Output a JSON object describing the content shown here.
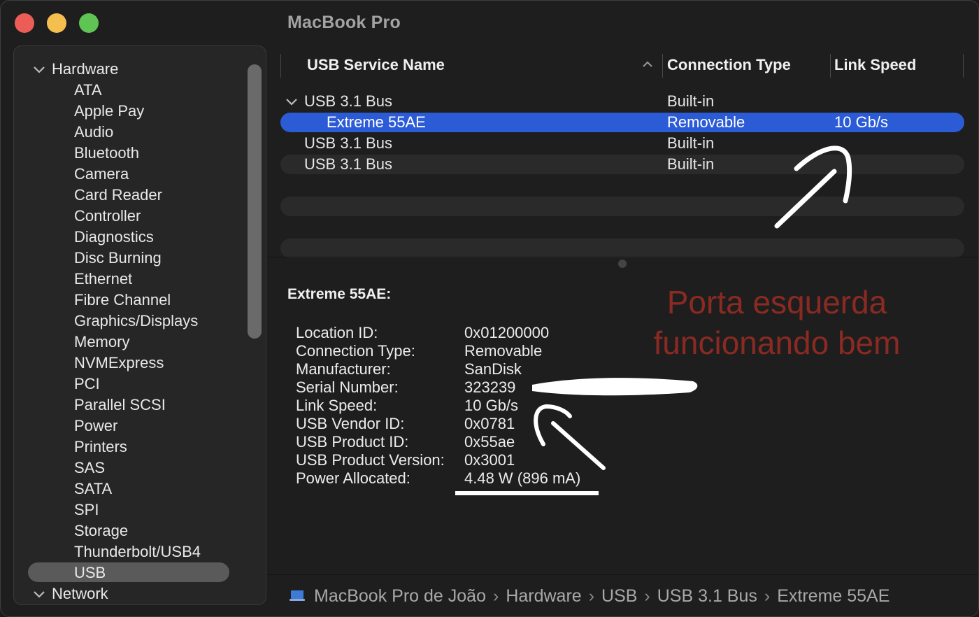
{
  "window": {
    "title": "MacBook Pro"
  },
  "sidebar": {
    "hardware_label": "Hardware",
    "network_label": "Network",
    "items": [
      "ATA",
      "Apple Pay",
      "Audio",
      "Bluetooth",
      "Camera",
      "Card Reader",
      "Controller",
      "Diagnostics",
      "Disc Burning",
      "Ethernet",
      "Fibre Channel",
      "Graphics/Displays",
      "Memory",
      "NVMExpress",
      "PCI",
      "Parallel SCSI",
      "Power",
      "Printers",
      "SAS",
      "SATA",
      "SPI",
      "Storage",
      "Thunderbolt/USB4",
      "USB"
    ],
    "selected_item": "USB"
  },
  "table": {
    "headers": {
      "name": "USB Service Name",
      "type": "Connection Type",
      "speed": "Link Speed"
    },
    "rows": [
      {
        "name": "USB 3.1 Bus",
        "type": "Built-in",
        "speed": ""
      },
      {
        "name": "Extreme 55AE",
        "type": "Removable",
        "speed": "10 Gb/s"
      },
      {
        "name": "USB 3.1 Bus",
        "type": "Built-in",
        "speed": ""
      },
      {
        "name": "USB 3.1 Bus",
        "type": "Built-in",
        "speed": ""
      }
    ]
  },
  "detail": {
    "title": "Extreme 55AE:",
    "properties": [
      {
        "key": "Location ID:",
        "value": "0x01200000"
      },
      {
        "key": "Connection Type:",
        "value": "Removable"
      },
      {
        "key": "Manufacturer:",
        "value": "SanDisk"
      },
      {
        "key": "Serial Number:",
        "value": "323239"
      },
      {
        "key": "Link Speed:",
        "value": "10 Gb/s"
      },
      {
        "key": "USB Vendor ID:",
        "value": "0x0781"
      },
      {
        "key": "USB Product ID:",
        "value": "0x55ae"
      },
      {
        "key": "USB Product Version:",
        "value": "0x3001"
      },
      {
        "key": "Power Allocated:",
        "value": "4.48 W (896 mA)"
      }
    ]
  },
  "annotation": {
    "line1": "Porta esquerda",
    "line2": "funcionando bem"
  },
  "breadcrumb": [
    "MacBook Pro de João",
    "Hardware",
    "USB",
    "USB 3.1 Bus",
    "Extreme 55AE"
  ],
  "colors": {
    "selection": "#2c5bd6",
    "annotation": "#8a2a22"
  },
  "icons": [
    "chevron-down-icon",
    "sort-ascending-icon",
    "laptop-icon"
  ]
}
